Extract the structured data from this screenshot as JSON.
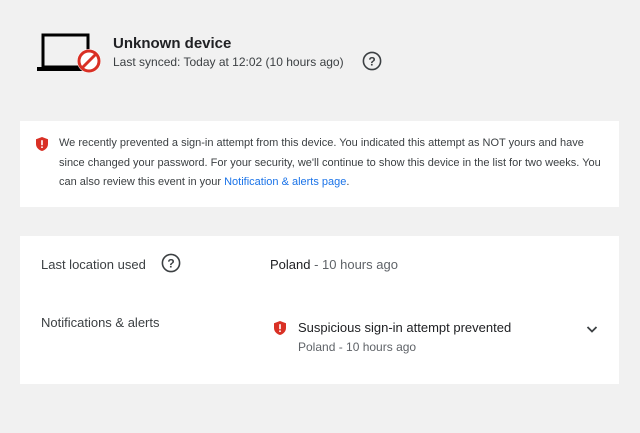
{
  "device": {
    "name": "Unknown device",
    "last_synced": "Last synced: Today at 12:02 (10 hours ago)",
    "icon": "laptop-blocked-icon"
  },
  "notice": {
    "icon": "shield-alert-icon",
    "text": "We recently prevented a sign-in attempt from this device. You indicated this attempt as NOT yours and have since changed your password. For your security, we'll continue to show this device in the list for two weeks. You can also review this event in your ",
    "link": "Notification & alerts page",
    "suffix": "."
  },
  "details": {
    "location_label": "Last location used",
    "location_value": "Poland",
    "location_time": " - 10 hours ago",
    "notifications_label": "Notifications & alerts",
    "alert_title": "Suspicious sign-in attempt prevented",
    "alert_subtitle": "Poland - 10 hours ago"
  },
  "colors": {
    "background": "#f1f1f1",
    "card": "#ffffff",
    "alert_red": "#d93025",
    "link": "#1a73e8"
  }
}
